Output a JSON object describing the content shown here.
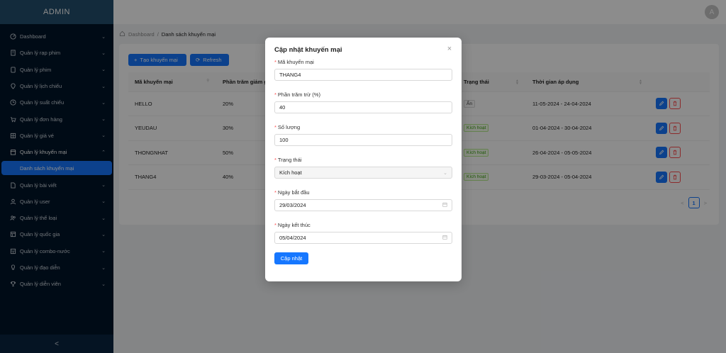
{
  "app": {
    "logo": "ADMIN",
    "avatar_initial": "A"
  },
  "sidebar": {
    "items": [
      {
        "label": "Dashboard",
        "icon": "dashboard-icon",
        "caret": "⌄"
      },
      {
        "label": "Quản lý rạp phim",
        "icon": "building-icon",
        "caret": "⌄"
      },
      {
        "label": "Quản lý phim",
        "icon": "film-icon",
        "caret": "⌄"
      },
      {
        "label": "Quản lý lịch chiếu",
        "icon": "location-icon",
        "caret": "⌄"
      },
      {
        "label": "Quản lý suất chiếu",
        "icon": "clock-icon",
        "caret": "⌄"
      },
      {
        "label": "Quản lý đơn hàng",
        "icon": "cart-icon",
        "caret": "⌄"
      },
      {
        "label": "Quản lý giá vé",
        "icon": "ticket-icon",
        "caret": "⌄"
      },
      {
        "label": "Quản lý khuyến mại",
        "icon": "shop-icon",
        "caret": "⌃"
      },
      {
        "label": "Quản lý bài viết",
        "icon": "file-icon",
        "caret": "⌄"
      },
      {
        "label": "Quản lý user",
        "icon": "user-icon",
        "caret": "⌄"
      },
      {
        "label": "Quản lý thể loại",
        "icon": "team-icon",
        "caret": "⌄"
      },
      {
        "label": "Quản lý quốc gia",
        "icon": "flag-icon",
        "caret": "⌄"
      },
      {
        "label": "Quản lý combo-nước",
        "icon": "table-icon",
        "caret": "⌄"
      },
      {
        "label": "Quản lý đạo diễn",
        "icon": "bulb-icon",
        "caret": "⌄"
      },
      {
        "label": "Quản lý diễn viên",
        "icon": "trophy-icon",
        "caret": "⌄"
      }
    ],
    "sub_active": "Danh sách khuyến mại",
    "collapse": "<"
  },
  "breadcrumb": {
    "home": "Dashboard",
    "separator": "/",
    "current": "Danh sách khuyến mại"
  },
  "toolbar": {
    "create_label": "Tạo khuyến mại",
    "refresh_label": "Refresh"
  },
  "table": {
    "headers": [
      "Mã khuyến mại",
      "Phần trăm giảm giá",
      "Trạng thái",
      "Thời gian áp dụng"
    ],
    "rows": [
      {
        "code": "HELLO",
        "percent": "20%",
        "status": "Ẩn",
        "status_color": "#d9d9d9",
        "period": "11-05-2024 - 24-04-2024"
      },
      {
        "code": "YEUDAU",
        "percent": "30%",
        "status": "Kích hoạt",
        "status_color": "#b7eb8f",
        "period": "01-04-2024 - 30-04-2024"
      },
      {
        "code": "THONGNHAT",
        "percent": "50%",
        "status": "Kích hoạt",
        "status_color": "#b7eb8f",
        "period": "26-04-2024 - 05-05-2024"
      },
      {
        "code": "THANG4",
        "percent": "40%",
        "status": "Kích hoạt",
        "status_color": "#b7eb8f",
        "period": "29-03-2024 - 05-04-2024"
      }
    ]
  },
  "pagination": {
    "prev": "<",
    "current": "1",
    "next": ">"
  },
  "modal": {
    "title": "Cập nhật khuyến mại",
    "close": "×",
    "fields": [
      {
        "label": "Mã khuyến mại",
        "value": "THANG4"
      },
      {
        "label": "Phần trăm trừ (%)",
        "value": "40"
      },
      {
        "label": "Số lượng",
        "value": "100"
      },
      {
        "label": "Trạng thái",
        "value": "Kích hoạt"
      },
      {
        "label": "Ngày bắt đầu",
        "value": "29/03/2024"
      },
      {
        "label": "Ngày kết thúc",
        "value": "05/04/2024"
      }
    ],
    "required_mark": "*",
    "submit_label": "Cập nhật"
  },
  "colors": {
    "primary": "#1677ff",
    "sidebar_bg": "#001529",
    "logo_bg": "#244f6d",
    "danger": "#ff4d4f"
  }
}
